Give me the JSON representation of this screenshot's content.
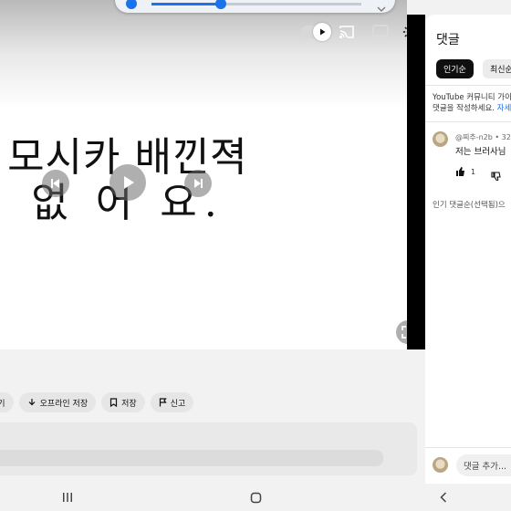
{
  "video": {
    "caption_line1": "모시카 배낀젹",
    "caption_line2": "없 어 요."
  },
  "seek": {
    "progress": 0.33
  },
  "actions": [
    {
      "label": "듣기",
      "icon": "none"
    },
    {
      "label": "오프라인 저장",
      "icon": "download-icon"
    },
    {
      "label": "저장",
      "icon": "bookmark-icon"
    },
    {
      "label": "신고",
      "icon": "flag-icon"
    }
  ],
  "comments": {
    "title": "댓글",
    "sort_popular": "인기순",
    "sort_newest": "최신순",
    "guide_line1": "YouTube 커뮤니티 가이",
    "guide_line2_prefix": "댓글을 작성하세요.",
    "guide_link": "자세",
    "first": {
      "meta": "@찌추-n2b • 32",
      "text": "저는 브러사님",
      "likes": "1"
    },
    "more": "인기 댓글순(선택됨)으",
    "input_placeholder": "댓글 추가..."
  },
  "colors": {
    "accent": "#1a73e8",
    "panel_bg": "#ffffff",
    "chip_bg": "#e6e6e6"
  }
}
